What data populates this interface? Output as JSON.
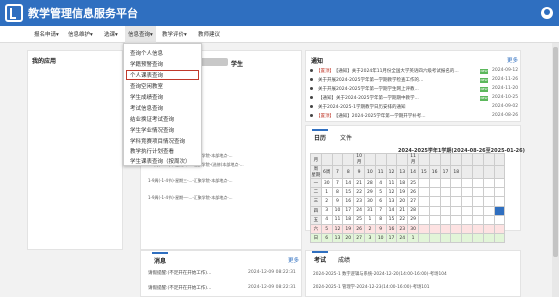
{
  "header": {
    "title": "教学管理信息服务平台"
  },
  "nav": [
    {
      "label": "报名申请▾"
    },
    {
      "label": "信息维护▾"
    },
    {
      "label": "选课▾"
    },
    {
      "label": "信息查询▾"
    },
    {
      "label": "教学评价▾"
    },
    {
      "label": "教师建议"
    }
  ],
  "dropdown": [
    {
      "label": "查询个人信息"
    },
    {
      "label": "学籍预警查询"
    },
    {
      "label": "个人课表查询"
    },
    {
      "label": "查询空闲教室"
    },
    {
      "label": "学生成绩查询"
    },
    {
      "label": "考试信息查询"
    },
    {
      "label": "结业换证考试查询"
    },
    {
      "label": "学生学业情况查询"
    },
    {
      "label": "学科竞赛项目情况查询"
    },
    {
      "label": "教学执行计划查看"
    },
    {
      "label": "学生课表查询（按周次）"
    }
  ],
  "apps": {
    "title": "我的应用"
  },
  "profile": {
    "suffix": "学生"
  },
  "notices": {
    "title": "通知",
    "more": "更多",
    "items": [
      {
        "tag": "【置顶】",
        "text": "【通知】关于2024年11月份全国大学英语四六级考试报名的...",
        "badge": "NEW",
        "date": "2024-09-12"
      },
      {
        "tag": "",
        "text": "关于开展2024-2025学年第一学期教学检查工作的...",
        "badge": "NEW",
        "date": "2024-11-26"
      },
      {
        "tag": "",
        "text": "关于开展2024-2025学年第一学期学生网上评教...",
        "badge": "NEW",
        "date": "2024-11-20"
      },
      {
        "tag": "",
        "text": "【通知】关于2024-2025学年第一学期期中教学...",
        "badge": "NEW",
        "date": "2024-10-25"
      },
      {
        "tag": "",
        "text": "关于2024-2025-1学期教学日历安排的通知",
        "badge": "",
        "date": "2024-09-02"
      },
      {
        "tag": "【置顶】",
        "text": "【通知】2024-2025学年第一学期开学补考...",
        "badge": "",
        "date": "2024-08-26"
      }
    ]
  },
  "courses": [
    {
      "text": "1-9周(-1-4节)-星期二-...-汇聚学院-本部地点-..."
    },
    {
      "text": "1-9周(-1-4节)-星期四-...-汇聚学院-(选修)本部地点-..."
    },
    {
      "text": "1-9周(-1-4节)-星期三-...-汇聚学院-本部地点-..."
    },
    {
      "text": "1-9周(-1-4节)-星期一-...-汇聚学院-本部地点-..."
    }
  ],
  "calendar": {
    "tabs": [
      {
        "label": "日历"
      },
      {
        "label": "文件"
      }
    ],
    "title": "2024-2025学年1学期(2024-08-26至2025-01-26)",
    "header_months": {
      "mon": "月",
      "oct": "10月",
      "nov": "11月"
    },
    "header_week_label": "周\n星期",
    "week_nums": [
      "6周",
      "7",
      "8",
      "9",
      "10",
      "11",
      "12",
      "13",
      "14",
      "15",
      "16",
      "17",
      "18"
    ],
    "days": [
      {
        "label": "一",
        "cells": [
          "30",
          "7",
          "14",
          "21",
          "28",
          "4",
          "11",
          "18",
          "25",
          "",
          "",
          "",
          ""
        ]
      },
      {
        "label": "二",
        "cells": [
          "1",
          "8",
          "15",
          "22",
          "29",
          "5",
          "12",
          "19",
          "26",
          "",
          "",
          "",
          ""
        ]
      },
      {
        "label": "三",
        "cells": [
          "2",
          "9",
          "16",
          "23",
          "30",
          "6",
          "13",
          "20",
          "27",
          "",
          "",
          "",
          ""
        ]
      },
      {
        "label": "四",
        "cells": [
          "3",
          "10",
          "17",
          "24",
          "31",
          "7",
          "14",
          "21",
          "28",
          "",
          "",
          "",
          ""
        ]
      },
      {
        "label": "五",
        "cells": [
          "4",
          "11",
          "18",
          "25",
          "1",
          "8",
          "15",
          "22",
          "29",
          "",
          "",
          "",
          ""
        ]
      },
      {
        "label": "六",
        "cells": [
          "5",
          "12",
          "19",
          "26",
          "2",
          "9",
          "16",
          "23",
          "30",
          "",
          "",
          "",
          ""
        ]
      },
      {
        "label": "日",
        "cells": [
          "6",
          "13",
          "20",
          "27",
          "3",
          "10",
          "17",
          "24",
          "1",
          "",
          "",
          "",
          ""
        ]
      }
    ]
  },
  "messages": {
    "title": "消息",
    "more": "更多",
    "items": [
      {
        "text": "请假提醒:(不足开在开始工作)...",
        "date": "2024-12-09 08:22:31"
      },
      {
        "text": "请假提醒:(不足开在开始工作)...",
        "date": "2024-12-09 08:22:31"
      }
    ]
  },
  "exams": {
    "tabs": [
      {
        "label": "考试"
      },
      {
        "label": "成绩"
      }
    ],
    "items": [
      {
        "text": "2024-2025-1 数字逻辑与系统-2024-12-20(14:00-16:00)-考场104"
      },
      {
        "text": "2024-2025-1 管理学-2024-12-23(14:00-16:00)-考场101"
      }
    ]
  },
  "colors": {
    "accent": "#2f6fc0",
    "highlight": "#c0392b",
    "badge": "#5cb85c"
  }
}
